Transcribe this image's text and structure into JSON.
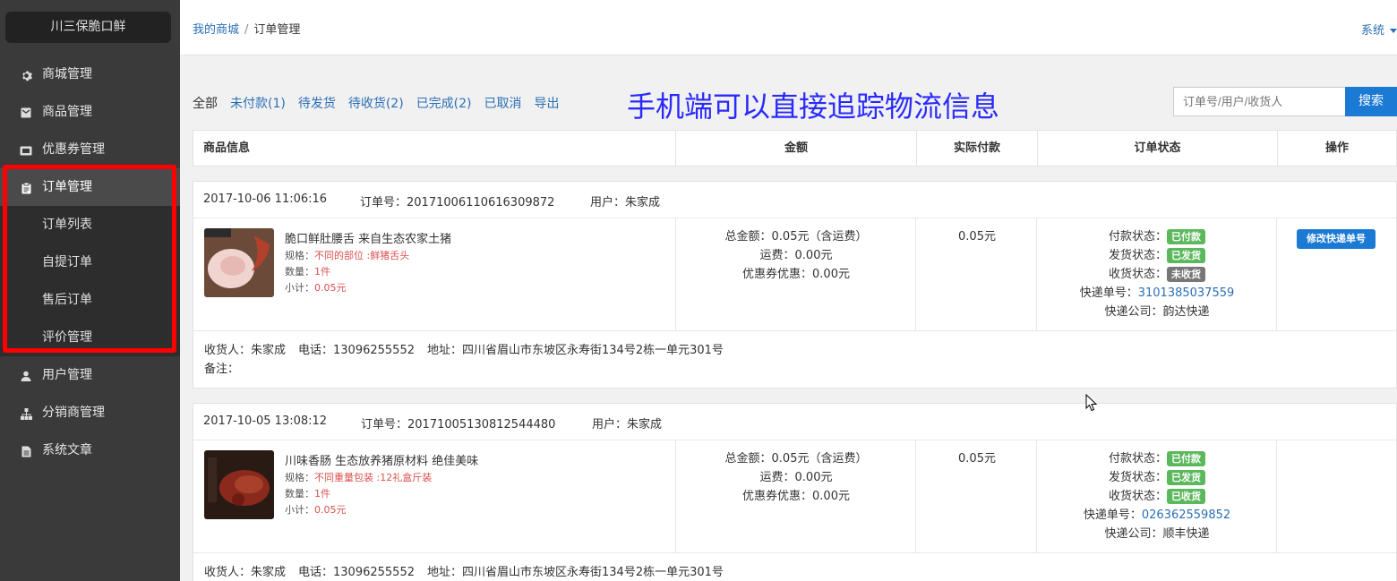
{
  "sidebar": {
    "brand": "川三保脆口鲜",
    "items": [
      {
        "label": "商城管理",
        "icon": "gear-icon"
      },
      {
        "label": "商品管理",
        "icon": "product-icon"
      },
      {
        "label": "优惠券管理",
        "icon": "ticket-icon"
      },
      {
        "label": "订单管理",
        "icon": "clipboard-icon"
      },
      {
        "label": "用户管理",
        "icon": "user-icon"
      },
      {
        "label": "分销商管理",
        "icon": "sitemap-icon"
      },
      {
        "label": "系统文章",
        "icon": "file-icon"
      }
    ],
    "subitems": [
      "订单列表",
      "自提订单",
      "售后订单",
      "评价管理"
    ]
  },
  "topbar": {
    "crumb_home": "我的商城",
    "crumb_sep": "/",
    "crumb_current": "订单管理",
    "system_menu": "系统"
  },
  "filters": [
    "全部",
    "未付款(1)",
    "待发货",
    "待收货(2)",
    "已完成(2)",
    "已取消",
    "导出"
  ],
  "annotation": "手机端可以直接追踪物流信息",
  "search": {
    "placeholder": "订单号/用户/收货人",
    "button": "搜索"
  },
  "table_headers": [
    "商品信息",
    "金额",
    "实际付款",
    "订单状态",
    "操作"
  ],
  "orders": [
    {
      "time": "2017-10-06 11:06:16",
      "order_no": "订单号：20171006110616309872",
      "user": "用户：朱家成",
      "product_name": "脆口鲜肚腰舌 来自生态农家土猪",
      "spec_label": "规格：",
      "spec_value": "不同的部位 :鲜猪舌头",
      "qty_label": "数量：",
      "qty_value": "1件",
      "subtotal_label": "小计：",
      "subtotal_value": "0.05元",
      "total": "总金额：0.05元（含运费）",
      "shipping": "运费：0.00元",
      "coupon": "优惠券优惠：0.00元",
      "paid": "0.05元",
      "pay_status_label": "付款状态：",
      "pay_status": "已付款",
      "ship_status_label": "发货状态：",
      "ship_status": "已发货",
      "recv_status_label": "收货状态：",
      "recv_status": "未收货",
      "tracking_label": "快递单号：",
      "tracking_no": "3101385037559",
      "carrier": "快递公司：韵达快递",
      "action": "修改快递单号",
      "receiver": "收货人：朱家成",
      "phone": "电话：13096255552",
      "address": "地址：四川省眉山市东坡区永寿街134号2栋一单元301号",
      "note": "备注："
    },
    {
      "time": "2017-10-05 13:08:12",
      "order_no": "订单号：20171005130812544480",
      "user": "用户：朱家成",
      "product_name": "川味香肠 生态放养猪原材料 绝佳美味",
      "spec_label": "规格：",
      "spec_value": "不同重量包装 :12礼盒斤装",
      "qty_label": "数量：",
      "qty_value": "1件",
      "subtotal_label": "小计：",
      "subtotal_value": "0.05元",
      "total": "总金额：0.05元（含运费）",
      "shipping": "运费：0.00元",
      "coupon": "优惠券优惠：0.00元",
      "paid": "0.05元",
      "pay_status_label": "付款状态：",
      "pay_status": "已付款",
      "ship_status_label": "发货状态：",
      "ship_status": "已发货",
      "recv_status_label": "收货状态：",
      "recv_status": "已收货",
      "tracking_label": "快递单号：",
      "tracking_no": "026362559852",
      "carrier": "快递公司：顺丰快递",
      "receiver": "收货人：朱家成",
      "phone": "电话：13096255552",
      "address": "地址：四川省眉山市东坡区永寿街134号2栋一单元301号"
    }
  ],
  "colors": {
    "accent": "#1b7ad4",
    "link": "#2a6fb5",
    "badge_green": "#5cb85c",
    "badge_gray": "#777777",
    "highlight": "#ff0000"
  }
}
